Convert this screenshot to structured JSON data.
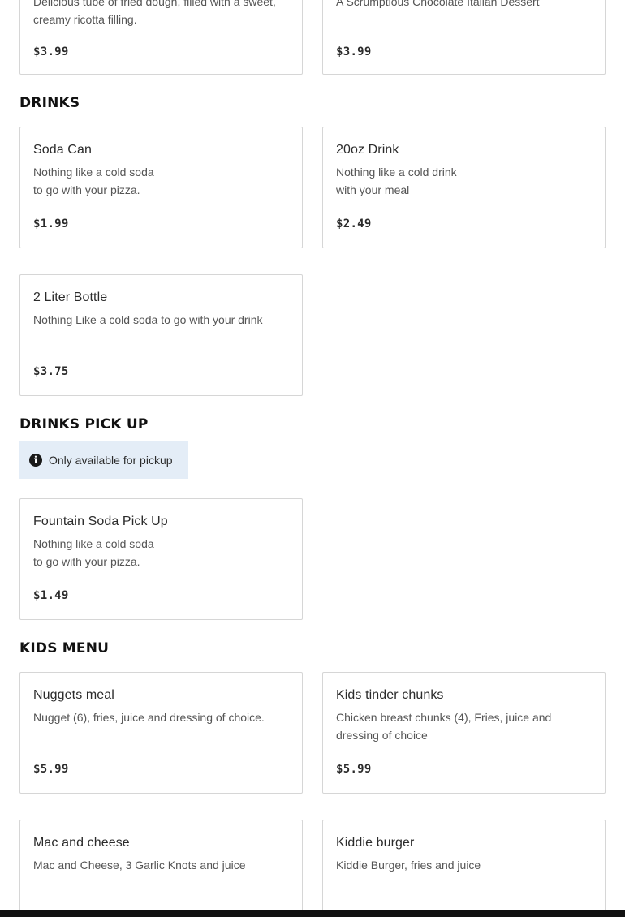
{
  "dessert_section": {
    "items": [
      {
        "name": "",
        "description": "Delicious tube of fried dough, filled with a sweet, creamy ricotta filling.",
        "price": "$3.99"
      },
      {
        "name": "",
        "description": "A Scrumptious Chocolate Italian Dessert",
        "price": "$3.99"
      }
    ]
  },
  "drinks": {
    "heading": "DRINKS",
    "items": [
      {
        "name": "Soda Can",
        "description_line1": "Nothing like a cold soda",
        "description_line2": "to go with your pizza.",
        "price": "$1.99"
      },
      {
        "name": "20oz Drink",
        "description_line1": "Nothing like a cold drink",
        "description_line2": "with your meal",
        "price": "$2.49"
      },
      {
        "name": "2 Liter Bottle",
        "description_line1": "Nothing Like a cold soda to go with your drink",
        "description_line2": "",
        "price": "$3.75"
      }
    ]
  },
  "drinks_pickup": {
    "heading": "DRINKS PICK UP",
    "notice": "Only available for pickup",
    "items": [
      {
        "name": "Fountain Soda Pick Up",
        "description_line1": "Nothing like a cold soda",
        "description_line2": "to go with your pizza.",
        "price": "$1.49"
      }
    ]
  },
  "kids_menu": {
    "heading": "KIDS MENU",
    "items": [
      {
        "name": "Nuggets meal",
        "description": "Nugget (6), fries, juice and dressing of choice.",
        "price": "$5.99"
      },
      {
        "name": "Kids tinder chunks",
        "description_line1": "Chicken breast chunks (4), Fries, juice and",
        "description_line2": "dressing of choice",
        "price": "$5.99"
      },
      {
        "name": "Mac and cheese",
        "description": "Mac and Cheese, 3 Garlic Knots and juice",
        "price": ""
      },
      {
        "name": "Kiddie burger",
        "description": "Kiddie Burger, fries and juice",
        "price": ""
      }
    ]
  },
  "icons": {
    "notice_icon": "info-circle-icon"
  }
}
